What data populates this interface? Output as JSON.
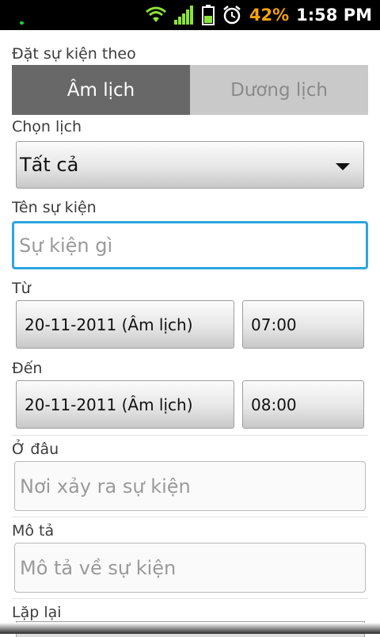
{
  "statusbar": {
    "battery_percent": "42%",
    "time": "1:58 PM",
    "colors": {
      "battery_text": "#f2a20b",
      "signal": "#8be33b"
    }
  },
  "form": {
    "mode_label": "Đặt sự kiện theo",
    "mode_tabs": [
      {
        "label": "Âm lịch",
        "active": true
      },
      {
        "label": "Dương lịch",
        "active": false
      }
    ],
    "calendar_label": "Chọn lịch",
    "calendar_value": "Tất cả",
    "name_label": "Tên sự kiện",
    "name_placeholder": "Sự kiện gì",
    "from_label": "Từ",
    "from_date": "20-11-2011 (Âm lịch)",
    "from_time": "07:00",
    "to_label": "Đến",
    "to_date": "20-11-2011 (Âm lịch)",
    "to_time": "08:00",
    "where_label": "Ở đâu",
    "where_placeholder": "Nơi xảy ra sự kiện",
    "desc_label": "Mô tả",
    "desc_placeholder": "Mô tả về sự kiện",
    "repeat_label": "Lặp lại"
  },
  "colors": {
    "focus_border": "#2aa5e0",
    "active_tab": "#686868",
    "inactive_tab": "#c9c9c9"
  }
}
